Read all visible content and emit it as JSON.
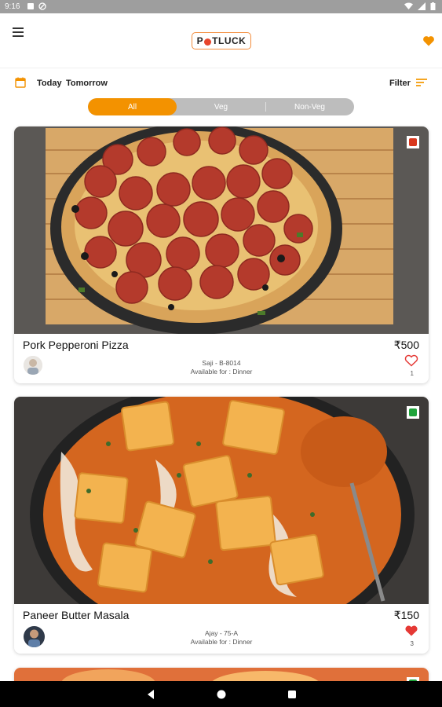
{
  "status_bar": {
    "time": "9:16"
  },
  "app_bar": {
    "logo_text_a": "P",
    "logo_text_b": "TLUCK"
  },
  "date_filter": {
    "today": "Today",
    "tomorrow": "Tomorrow",
    "filter": "Filter"
  },
  "segments": [
    {
      "label": "All",
      "active": true
    },
    {
      "label": "Veg",
      "active": false
    },
    {
      "label": "Non-Veg",
      "active": false
    }
  ],
  "cards": [
    {
      "title": "Pork Pepperoni Pizza",
      "price": "₹500",
      "seller": "Saji - B-8014",
      "available": "Available for : Dinner",
      "likes": "1",
      "liked": false,
      "diet": "non-veg",
      "diet_color": "#d9381e"
    },
    {
      "title": "Paneer Butter Masala",
      "price": "₹150",
      "seller": "Ajay  - 75-A",
      "available": "Available for : Dinner",
      "likes": "3",
      "liked": true,
      "diet": "veg",
      "diet_color": "#1fa33a"
    }
  ],
  "colors": {
    "accent": "#f39200",
    "like": "#e53935"
  }
}
